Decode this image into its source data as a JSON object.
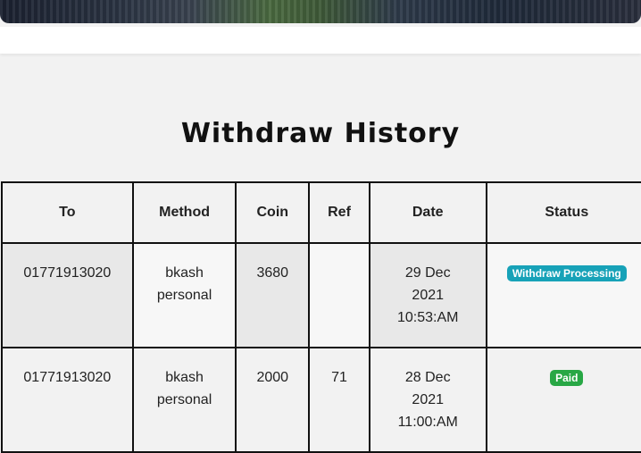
{
  "page": {
    "title": "Withdraw History"
  },
  "table": {
    "headers": [
      "To",
      "Method",
      "Coin",
      "Ref",
      "Date",
      "Status"
    ],
    "rows": [
      {
        "to": "01771913020",
        "method_line1": "bkash",
        "method_line2": "personal",
        "coin": "3680",
        "ref": "",
        "date_line1": "29 Dec",
        "date_line2": "2021",
        "date_line3": "10:53:AM",
        "status": "Withdraw Processing",
        "status_color": "#17a2b8"
      },
      {
        "to": "01771913020",
        "method_line1": "bkash",
        "method_line2": "personal",
        "coin": "2000",
        "ref": "71",
        "date_line1": "28 Dec",
        "date_line2": "2021",
        "date_line3": "11:00:AM",
        "status": "Paid",
        "status_color": "#28a745"
      }
    ]
  }
}
